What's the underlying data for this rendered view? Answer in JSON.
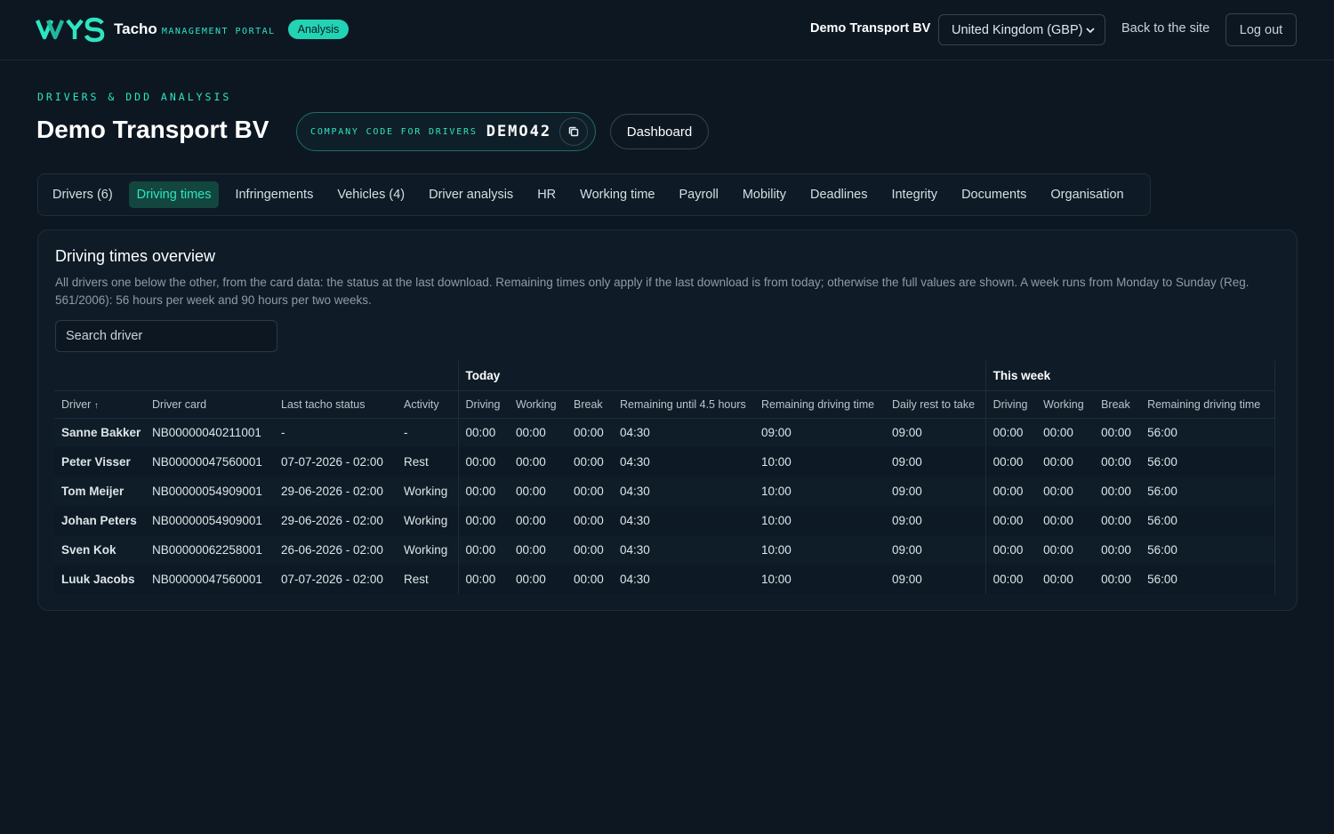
{
  "header": {
    "brand_name": "Tacho",
    "brand_sub": "Management Portal",
    "badge": "Analysis",
    "company": "Demo Transport BV",
    "region": "United Kingdom (GBP)",
    "back_link": "Back to the site",
    "logout": "Log out"
  },
  "page": {
    "eyebrow": "Drivers & DDD analysis",
    "title": "Demo Transport BV",
    "code_label": "Company code for drivers",
    "code_value": "DEMO42",
    "dashboard": "Dashboard"
  },
  "tabs": [
    {
      "label": "Drivers (6)"
    },
    {
      "label": "Driving times"
    },
    {
      "label": "Infringements"
    },
    {
      "label": "Vehicles (4)"
    },
    {
      "label": "Driver analysis"
    },
    {
      "label": "HR"
    },
    {
      "label": "Working time"
    },
    {
      "label": "Payroll"
    },
    {
      "label": "Mobility"
    },
    {
      "label": "Deadlines"
    },
    {
      "label": "Integrity"
    },
    {
      "label": "Documents"
    },
    {
      "label": "Organisation"
    }
  ],
  "overview": {
    "title": "Driving times overview",
    "description": "All drivers one below the other, from the card data: the status at the last download. Remaining times only apply if the last download is from today; otherwise the full values are shown. A week runs from Monday to Sunday (Reg. 561/2006): 56 hours per week and 90 hours per two weeks.",
    "search_placeholder": "Search driver",
    "group_today": "Today",
    "group_week": "This week",
    "columns": [
      "Driver",
      "Driver card",
      "Last tacho status",
      "Activity",
      "Driving",
      "Working",
      "Break",
      "Remaining until 4.5 hours",
      "Remaining driving time",
      "Daily rest to take",
      "Driving",
      "Working",
      "Break",
      "Remaining driving time"
    ],
    "rows": [
      {
        "driver": "Sanne Bakker",
        "card": "NB00000040211001",
        "status": "-",
        "activity": "-",
        "drv": "00:00",
        "wrk": "00:00",
        "brk": "00:00",
        "rem45": "04:30",
        "remdrv": "09:00",
        "rest": "09:00",
        "wdrv": "00:00",
        "wwrk": "00:00",
        "wbrk": "00:00",
        "wrem": "56:00"
      },
      {
        "driver": "Peter Visser",
        "card": "NB00000047560001",
        "status": "07-07-2026 - 02:00",
        "activity": "Rest",
        "drv": "00:00",
        "wrk": "00:00",
        "brk": "00:00",
        "rem45": "04:30",
        "remdrv": "10:00",
        "rest": "09:00",
        "wdrv": "00:00",
        "wwrk": "00:00",
        "wbrk": "00:00",
        "wrem": "56:00"
      },
      {
        "driver": "Tom Meijer",
        "card": "NB00000054909001",
        "status": "29-06-2026 - 02:00",
        "activity": "Working",
        "drv": "00:00",
        "wrk": "00:00",
        "brk": "00:00",
        "rem45": "04:30",
        "remdrv": "10:00",
        "rest": "09:00",
        "wdrv": "00:00",
        "wwrk": "00:00",
        "wbrk": "00:00",
        "wrem": "56:00"
      },
      {
        "driver": "Johan Peters",
        "card": "NB00000054909001",
        "status": "29-06-2026 - 02:00",
        "activity": "Working",
        "drv": "00:00",
        "wrk": "00:00",
        "brk": "00:00",
        "rem45": "04:30",
        "remdrv": "10:00",
        "rest": "09:00",
        "wdrv": "00:00",
        "wwrk": "00:00",
        "wbrk": "00:00",
        "wrem": "56:00"
      },
      {
        "driver": "Sven Kok",
        "card": "NB00000062258001",
        "status": "26-06-2026 - 02:00",
        "activity": "Working",
        "drv": "00:00",
        "wrk": "00:00",
        "brk": "00:00",
        "rem45": "04:30",
        "remdrv": "10:00",
        "rest": "09:00",
        "wdrv": "00:00",
        "wwrk": "00:00",
        "wbrk": "00:00",
        "wrem": "56:00"
      },
      {
        "driver": "Luuk Jacobs",
        "card": "NB00000047560001",
        "status": "07-07-2026 - 02:00",
        "activity": "Rest",
        "drv": "00:00",
        "wrk": "00:00",
        "brk": "00:00",
        "rem45": "04:30",
        "remdrv": "10:00",
        "rest": "09:00",
        "wdrv": "00:00",
        "wwrk": "00:00",
        "wbrk": "00:00",
        "wrem": "56:00"
      }
    ]
  }
}
